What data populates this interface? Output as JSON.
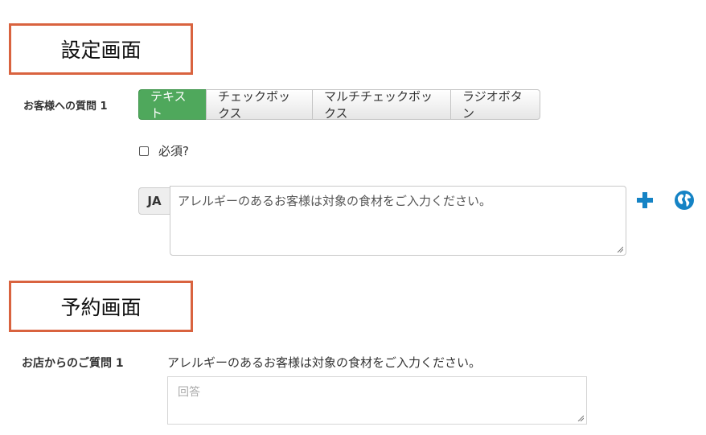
{
  "settings_section": {
    "title": "設定画面"
  },
  "question": {
    "label": "お客様への質問 1",
    "types": [
      {
        "label": "テキスト",
        "active": true
      },
      {
        "label": "チェックボックス",
        "active": false
      },
      {
        "label": "マルチチェックボックス",
        "active": false
      },
      {
        "label": "ラジオボタン",
        "active": false
      }
    ],
    "required_label": "必須?",
    "required_checked": false,
    "language_code": "JA",
    "question_text": "アレルギーのあるお客様は対象の食材をご入力ください。",
    "add_icon": "plus-icon",
    "translate_icon": "globe-icon"
  },
  "booking_section": {
    "title": "予約画面"
  },
  "booking": {
    "label": "お店からのご質問 1",
    "question_text": "アレルギーのあるお客様は対象の食材をご入力ください。",
    "answer_placeholder": "回答"
  },
  "colors": {
    "accent_box": "#d9633f",
    "active_button": "#4fa85c",
    "icon_blue": "#1583c5"
  }
}
